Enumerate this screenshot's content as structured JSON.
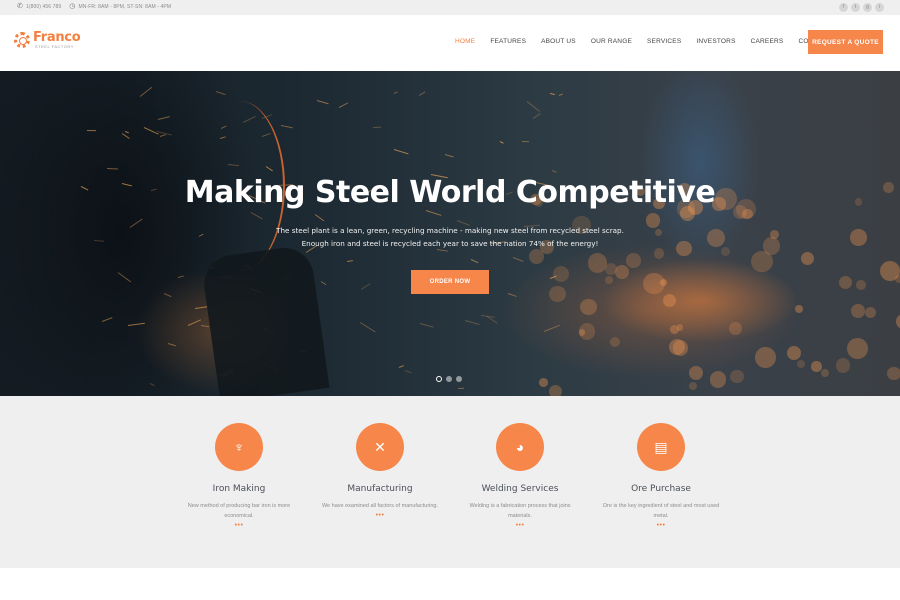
{
  "topbar": {
    "phone": "1(800) 456 789",
    "hours": "MN-FR: 8AM - 8PM, ST-SN: 8AM - 4PM",
    "social": [
      {
        "icon": "facebook-icon",
        "glyph": "f"
      },
      {
        "icon": "twitter-icon",
        "glyph": "t"
      },
      {
        "icon": "google-plus-icon",
        "glyph": "g"
      },
      {
        "icon": "instagram-icon",
        "glyph": "i"
      }
    ]
  },
  "header": {
    "logo_name": "Franco",
    "logo_tagline": "STEEL FACTORY",
    "nav": [
      "HOME",
      "FEATURES",
      "ABOUT US",
      "OUR RANGE",
      "SERVICES",
      "INVESTORS",
      "CAREERS",
      "CONTACTS"
    ],
    "active_nav": "HOME",
    "quote_button": "REQUEST A QUOTE"
  },
  "hero": {
    "title": "Making Steel World Competitive",
    "subtitle_line1": "The steel plant is a lean, green, recycling machine - making new steel from recycled steel scrap.",
    "subtitle_line2": "Enough iron and steel is recycled each year to save the nation 74% of the energy!",
    "cta": "ORDER NOW",
    "slides": 3,
    "active_slide": 1
  },
  "services": [
    {
      "icon": "iron-cauldron-icon",
      "glyph": "♆",
      "title": "Iron Making",
      "desc": "New method of producing bar iron is more economical.",
      "more": "•••"
    },
    {
      "icon": "tools-icon",
      "glyph": "✕",
      "title": "Manufacturing",
      "desc": "We have examined all factors of manufacturing.",
      "more": "•••"
    },
    {
      "icon": "welding-mask-icon",
      "glyph": "◕",
      "title": "Welding Services",
      "desc": "Welding is a fabrication process that joins materials.",
      "more": "•••"
    },
    {
      "icon": "ore-cart-icon",
      "glyph": "▤",
      "title": "Ore Purchase",
      "desc": "Ore is the key ingredient of steel and most used metal.",
      "more": "•••"
    }
  ],
  "colors": {
    "accent": "#f6864a",
    "topbar_bg": "#efefef",
    "services_bg": "#efefef",
    "heading_text": "#4a4f57"
  }
}
